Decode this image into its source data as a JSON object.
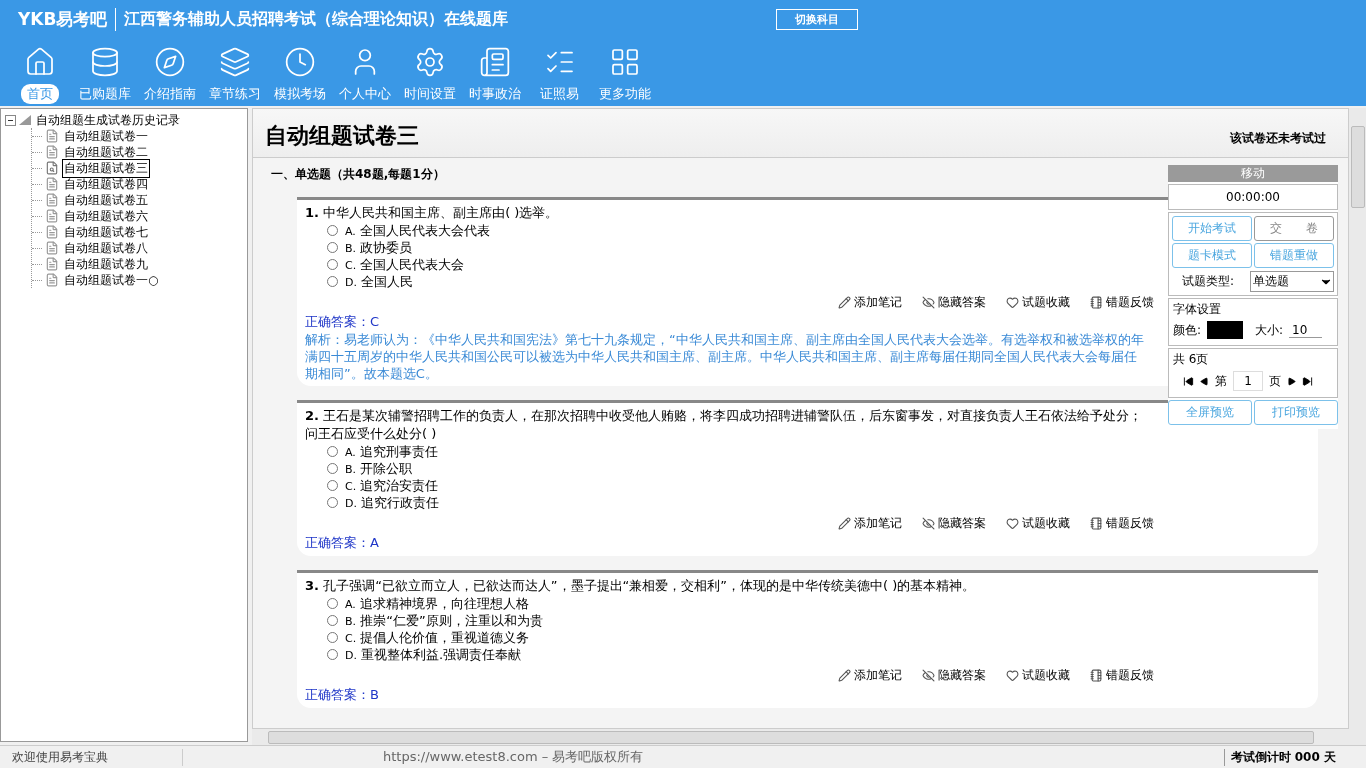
{
  "header": {
    "logo": "YKB易考吧",
    "title": "江西警务辅助人员招聘考试（综合理论知识）在线题库",
    "switch_button": "切换科目"
  },
  "nav": [
    {
      "label": "首页",
      "selected": true
    },
    {
      "label": "已购题库",
      "selected": false
    },
    {
      "label": "介绍指南",
      "selected": false
    },
    {
      "label": "章节练习",
      "selected": false
    },
    {
      "label": "模拟考场",
      "selected": false
    },
    {
      "label": "个人中心",
      "selected": false
    },
    {
      "label": "时间设置",
      "selected": false
    },
    {
      "label": "时事政治",
      "selected": false
    },
    {
      "label": "证照易",
      "selected": false
    },
    {
      "label": "更多功能",
      "selected": false
    }
  ],
  "tree": {
    "label": "自动组题生成试卷历史记录",
    "expanded": true,
    "children": [
      {
        "label": "自动组题试卷一",
        "selected": false
      },
      {
        "label": "自动组题试卷二",
        "selected": false
      },
      {
        "label": "自动组题试卷三",
        "selected": true
      },
      {
        "label": "自动组题试卷四",
        "selected": false
      },
      {
        "label": "自动组题试卷五",
        "selected": false
      },
      {
        "label": "自动组题试卷六",
        "selected": false
      },
      {
        "label": "自动组题试卷七",
        "selected": false
      },
      {
        "label": "自动组题试卷八",
        "selected": false
      },
      {
        "label": "自动组题试卷九",
        "selected": false
      },
      {
        "label": "自动组题试卷一○",
        "selected": false
      }
    ]
  },
  "paper": {
    "title": "自动组题试卷三",
    "status": "该试卷还未考试过",
    "section": "一、单选题（共48题,每题1分）",
    "questions": [
      {
        "number": "1.",
        "stem": "中华人民共和国主席、副主席由( )选举。",
        "options": [
          {
            "letter": "A.",
            "text": "全国人民代表大会代表",
            "selected": false
          },
          {
            "letter": "B.",
            "text": "政协委员",
            "selected": false
          },
          {
            "letter": "C.",
            "text": "全国人民代表大会",
            "selected": false
          },
          {
            "letter": "D.",
            "text": "全国人民",
            "selected": false
          }
        ],
        "actions": [
          "添加笔记",
          "隐藏答案",
          "试题收藏",
          "错题反馈"
        ],
        "answer": "正确答案：C",
        "explanation": "解析：易老师认为：《中华人民共和国宪法》第七十九条规定，“中华人民共和国主席、副主席由全国人民代表大会选举。有选举权和被选举权的年满四十五周岁的中华人民共和国公民可以被选为中华人民共和国主席、副主席。中华人民共和国主席、副主席每届任期同全国人民代表大会每届任期相同”。故本题选C。"
      },
      {
        "number": "2.",
        "stem": "王石是某次辅警招聘工作的负责人，在那次招聘中收受他人贿赂，将李四成功招聘进辅警队伍，后东窗事发，对直接负责人王石依法给予处分；问王石应受什么处分( )",
        "options": [
          {
            "letter": "A.",
            "text": "追究刑事责任",
            "selected": false
          },
          {
            "letter": "B.",
            "text": "开除公职",
            "selected": false
          },
          {
            "letter": "C.",
            "text": "追究治安责任",
            "selected": false
          },
          {
            "letter": "D.",
            "text": "追究行政责任",
            "selected": false
          }
        ],
        "actions": [
          "添加笔记",
          "隐藏答案",
          "试题收藏",
          "错题反馈"
        ],
        "answer": "正确答案：A"
      },
      {
        "number": "3.",
        "stem": "孔子强调“已欲立而立人，已欲达而达人”，墨子提出“兼相爱，交相利”，体现的是中华传统美德中( )的基本精神。",
        "options": [
          {
            "letter": "A.",
            "text": "追求精神境界，向往理想人格",
            "selected": false
          },
          {
            "letter": "B.",
            "text": "推崇“仁爱”原则，注重以和为贵",
            "selected": false
          },
          {
            "letter": "C.",
            "text": "提倡人伦价值，重视道德义务",
            "selected": false
          },
          {
            "letter": "D.",
            "text": "重视整体利益.强调责任奉献",
            "selected": false
          }
        ],
        "actions": [
          "添加笔记",
          "隐藏答案",
          "试题收藏",
          "错题反馈"
        ],
        "answer": "正确答案：B"
      }
    ]
  },
  "panel": {
    "title": "移动",
    "timer": "00:00:00",
    "buttons": [
      "开始考试",
      "交　　卷",
      "题卡模式",
      "错题重做"
    ],
    "type_label": "试题类型:",
    "type_value": "单选题",
    "font_group": "字体设置",
    "color_label": "颜色:",
    "color": "#000000",
    "size_label": "大小:",
    "size_value": "10",
    "page_group": "共 6页",
    "page_prefix": "第",
    "page_value": "1",
    "page_suffix": "页",
    "preview_buttons": [
      "全屏预览",
      "打印预览"
    ]
  },
  "status_bar": {
    "welcome": "欢迎使用易考宝典",
    "copyright": "https://www.etest8.com – 易考吧版权所有",
    "countdown": "考试倒计时 000 天"
  }
}
